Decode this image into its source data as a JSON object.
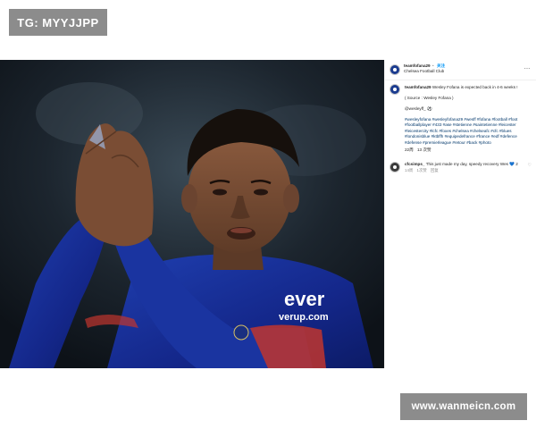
{
  "top_badge": {
    "text": "TG: MYYJJPP"
  },
  "post": {
    "header": {
      "username": "teamfofana29",
      "separator": "•",
      "follow_label": "关注",
      "subtitle": "Chelsea Football Club",
      "more_label": "…"
    },
    "caption": {
      "username": "teamfofana29",
      "text": "Wesley Fofana is expected back in 4-6 weeks !",
      "source": "( Source : Wesley Fofana )",
      "mention": "@wesleyff_ ⚽",
      "hashtags": "#wesleyfofana #wesleyfofana29 #wesff #fofana #football #foot #footballplayer #433 #ase #stetienne #saintetienne #leicester #leicestercity #lcfc #foxes #chelsea #chelseafc #cfc #blues #londonisblue #ktbffh #equipedefrance #france #edf #defence #defense #premierleague #retour #back #photo",
      "time": "22周",
      "likes": "13 次赞"
    },
    "comment": {
      "username": "cfcsimps_",
      "text": "This just made my day, speedy recovery Wes 💙",
      "badge": "2",
      "time": "14周",
      "likes_label": "1次赞",
      "reply_label": "回复"
    },
    "photo": {
      "alt_description": "",
      "sponsor_line1": "ever",
      "sponsor_line2": "verup.com"
    }
  },
  "watermark": {
    "text": "www.wanmeicn.com"
  }
}
